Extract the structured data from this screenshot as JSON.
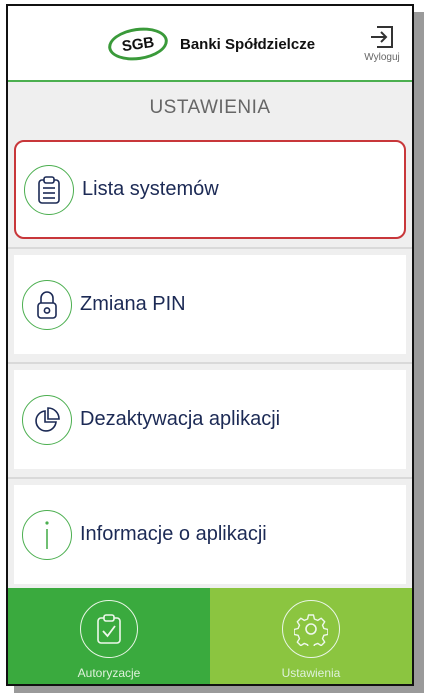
{
  "header": {
    "logo_mark": "SGB",
    "brand_name": "Banki Spółdzielcze",
    "logout_label": "Wyloguj",
    "logout_icon": "logout-icon"
  },
  "page": {
    "title": "USTAWIENIA"
  },
  "menu": {
    "items": [
      {
        "label": "Lista systemów",
        "icon": "clipboard-icon",
        "selected": true
      },
      {
        "label": "Zmiana PIN",
        "icon": "lock-icon",
        "selected": false
      },
      {
        "label": "Dezaktywacja aplikacji",
        "icon": "pie-chart-icon",
        "selected": false
      },
      {
        "label": "Informacje o aplikacji",
        "icon": "info-icon",
        "selected": false
      }
    ]
  },
  "tabs": [
    {
      "label": "Autoryzacje",
      "icon": "clipboard-check-icon",
      "active": false
    },
    {
      "label": "Ustawienia",
      "icon": "gear-icon",
      "active": true
    }
  ],
  "colors": {
    "accent_green": "#3aaa3e",
    "light_green": "#8bc540",
    "selected_border": "#c8373a",
    "label_navy": "#1c2a55"
  }
}
